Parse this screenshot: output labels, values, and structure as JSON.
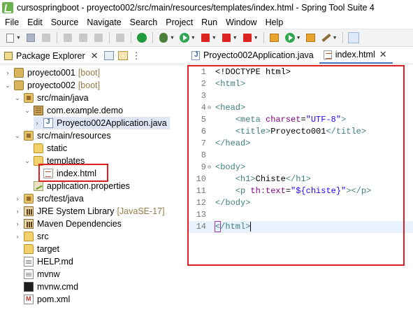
{
  "window": {
    "title": "cursospringboot - proyecto002/src/main/resources/templates/index.html - Spring Tool Suite 4"
  },
  "menu": [
    "File",
    "Edit",
    "Source",
    "Navigate",
    "Search",
    "Project",
    "Run",
    "Window",
    "Help"
  ],
  "package_explorer": {
    "title": "Package Explorer",
    "tree": [
      {
        "label": "proyecto001",
        "deco": "[boot]",
        "icon": "project-icon",
        "kind": "project",
        "expanded": false
      },
      {
        "label": "proyecto002",
        "deco": "[boot]",
        "icon": "project-icon",
        "kind": "project",
        "expanded": true
      },
      {
        "label": "src/main/java",
        "deco": "",
        "icon": "source-folder-icon",
        "kind": "srcfolder",
        "expanded": true
      },
      {
        "label": "com.example.demo",
        "deco": "",
        "icon": "package-icon",
        "kind": "package",
        "expanded": true
      },
      {
        "label": "Proyecto002Application.java",
        "deco": "",
        "icon": "java-file-icon",
        "kind": "java",
        "expanded": false
      },
      {
        "label": "src/main/resources",
        "deco": "",
        "icon": "source-folder-icon",
        "kind": "srcfolder",
        "expanded": true
      },
      {
        "label": "static",
        "deco": "",
        "icon": "folder-icon",
        "kind": "folder",
        "expanded": null
      },
      {
        "label": "templates",
        "deco": "",
        "icon": "folder-icon",
        "kind": "folder",
        "expanded": true
      },
      {
        "label": "index.html",
        "deco": "",
        "icon": "html-file-icon",
        "kind": "html",
        "expanded": null
      },
      {
        "label": "application.properties",
        "deco": "",
        "icon": "properties-file-icon",
        "kind": "props",
        "expanded": null
      },
      {
        "label": "src/test/java",
        "deco": "",
        "icon": "source-folder-icon",
        "kind": "srcfolder",
        "expanded": false
      },
      {
        "label": "JRE System Library",
        "deco": "[JavaSE-17]",
        "icon": "library-icon",
        "kind": "library",
        "expanded": false
      },
      {
        "label": "Maven Dependencies",
        "deco": "",
        "icon": "library-icon",
        "kind": "library",
        "expanded": false
      },
      {
        "label": "src",
        "deco": "",
        "icon": "folder-icon",
        "kind": "folder",
        "expanded": false
      },
      {
        "label": "target",
        "deco": "",
        "icon": "folder-icon",
        "kind": "folder",
        "expanded": null
      },
      {
        "label": "HELP.md",
        "deco": "",
        "icon": "markdown-file-icon",
        "kind": "file",
        "expanded": null
      },
      {
        "label": "mvnw",
        "deco": "",
        "icon": "file-icon",
        "kind": "file",
        "expanded": null
      },
      {
        "label": "mvnw.cmd",
        "deco": "",
        "icon": "cmd-file-icon",
        "kind": "cmd",
        "expanded": null
      },
      {
        "label": "pom.xml",
        "deco": "",
        "icon": "xml-file-icon",
        "kind": "xml",
        "expanded": null
      }
    ]
  },
  "editor": {
    "tabs": [
      {
        "label": "Proyecto002Application.java",
        "active": false
      },
      {
        "label": "index.html",
        "active": true
      }
    ],
    "lines": [
      {
        "n": "1",
        "fold": "",
        "segments": [
          [
            "txt",
            "<!DOCTYPE html>"
          ]
        ]
      },
      {
        "n": "2",
        "fold": "",
        "segments": [
          [
            "tag",
            "<html>"
          ]
        ]
      },
      {
        "n": "3",
        "fold": "",
        "segments": []
      },
      {
        "n": "4",
        "fold": "⊖",
        "segments": [
          [
            "tag",
            "<head>"
          ]
        ]
      },
      {
        "n": "5",
        "fold": "",
        "segments": [
          [
            "txt",
            "    "
          ],
          [
            "tag",
            "<meta "
          ],
          [
            "attr",
            "charset"
          ],
          [
            "txt",
            "="
          ],
          [
            "str",
            "\"UTF-8\""
          ],
          [
            "tag",
            ">"
          ]
        ]
      },
      {
        "n": "6",
        "fold": "",
        "segments": [
          [
            "txt",
            "    "
          ],
          [
            "tag",
            "<title>"
          ],
          [
            "txt",
            "Proyecto001"
          ],
          [
            "tag",
            "</title>"
          ]
        ]
      },
      {
        "n": "7",
        "fold": "",
        "segments": [
          [
            "tag",
            "</head>"
          ]
        ]
      },
      {
        "n": "8",
        "fold": "",
        "segments": []
      },
      {
        "n": "9",
        "fold": "⊖",
        "segments": [
          [
            "tag",
            "<body>"
          ]
        ]
      },
      {
        "n": "10",
        "fold": "",
        "segments": [
          [
            "txt",
            "    "
          ],
          [
            "tag",
            "<h1>"
          ],
          [
            "txt",
            "Chiste"
          ],
          [
            "tag",
            "</h1>"
          ]
        ]
      },
      {
        "n": "11",
        "fold": "",
        "segments": [
          [
            "txt",
            "    "
          ],
          [
            "tag",
            "<p "
          ],
          [
            "attr",
            "th:text"
          ],
          [
            "txt",
            "="
          ],
          [
            "str",
            "\"${chiste}\""
          ],
          [
            "tag",
            "></p>"
          ]
        ]
      },
      {
        "n": "12",
        "fold": "",
        "segments": [
          [
            "tag",
            "</body>"
          ]
        ]
      },
      {
        "n": "13",
        "fold": "",
        "segments": []
      },
      {
        "n": "14",
        "fold": "",
        "segments": [
          [
            "tag",
            "</html>"
          ]
        ],
        "current": true
      }
    ]
  },
  "colors": {
    "tag": "#3f7f7f",
    "attr": "#7f007f",
    "string": "#2a00ff",
    "highlight_box": "#e02020",
    "current_line": "#e8f2fe"
  }
}
